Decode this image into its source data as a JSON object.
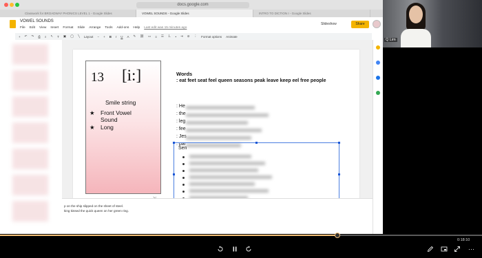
{
  "browser": {
    "url": "docs.google.com",
    "tabs": [
      "Classwork for BROADWAY PHONICS LEVEL 1 - Google Slides",
      "VOWEL SOUNDS - Google Slides",
      "INTRO TO DICTION I - Google Slides"
    ]
  },
  "app": {
    "title": "VOWEL SOUNDS",
    "menu": [
      "File",
      "Edit",
      "View",
      "Insert",
      "Format",
      "Slide",
      "Arrange",
      "Tools",
      "Add-ons",
      "Help"
    ],
    "last_edit": "Last edit was 15 minutes ago",
    "slideshow_label": "Slideshow",
    "share_label": "Share",
    "toolbar": {
      "layout_label": "Layout",
      "format_options": "Format options",
      "animate": "Animate"
    }
  },
  "slide": {
    "number": "13",
    "ipa": "[i:]",
    "smile": "Smile string",
    "bullets": [
      "Front  Vowel Sound",
      "Long"
    ],
    "words_title": "Words",
    "words": ": eat feet seat feel queen seasons peak leave keep eel free people",
    "cues": [
      ": He",
      ": the",
      ": leg",
      ": fee",
      ": Jes",
      ": par"
    ],
    "sentences_label": "Sen"
  },
  "notes": {
    "line1": "p on the ship slipped on the sheet of steel.",
    "line2": "king kissed the quick queen on her green ring."
  },
  "video": {
    "time": "0:18:10",
    "progress": 0.7
  },
  "webcam": {
    "name": "Q Lim"
  },
  "colors": {
    "accent": "#f4b400",
    "progress": "#f6c27a",
    "selection": "#4a7ee0"
  }
}
